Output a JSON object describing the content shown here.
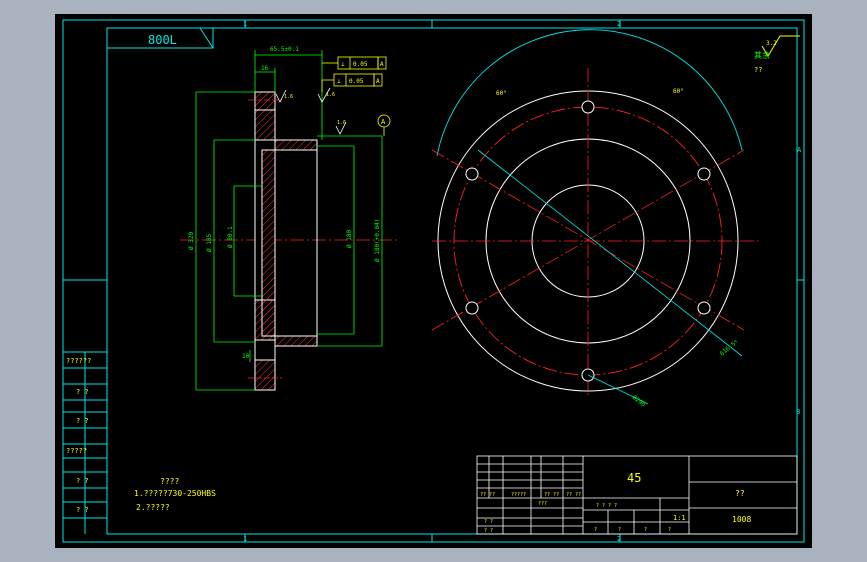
{
  "colors": {
    "background": "#000000",
    "frame": "#00e5e5",
    "outline": "#ffffff",
    "hatch": "#ff3030",
    "dimension": "#00ff00",
    "annotation": "#ffff00",
    "text": "#ffff00",
    "centerline": "#ff2020"
  },
  "drawing_number_box": "800L",
  "zone_labels": {
    "top1": "1",
    "top2": "2",
    "right_a": "A",
    "right_b": "B",
    "bottom1": "1",
    "bottom2": "2"
  },
  "roughness": {
    "value": "3.2",
    "mark": "其余",
    "note": "??"
  },
  "side_view": {
    "dim_top": "65.5±0.1",
    "dim_small": "16",
    "dim_small2": "12",
    "tol1_symbol": "⊥",
    "tol1_value": "0.05",
    "tol1_ref": "A",
    "tol2_symbol": "⊥",
    "tol2_value": "0.05",
    "tol2_ref": "A",
    "rough1": "1.6",
    "rough2": "1.6",
    "rough3": "1.6",
    "datum": "A",
    "dia_outer": "Ø 320",
    "dia_mid": "Ø 185",
    "dia_inner": "Ø 80.1",
    "dia_bore": "Ø 180",
    "dia_bore2": "Ø 180(+0.04)",
    "dim_bottom": "10"
  },
  "front_view": {
    "angle_left": "60°",
    "angle_right": "60°",
    "hole_label": "6ר16.5",
    "pcd_label": "Ø290"
  },
  "left_strip": [
    "??????",
    "? ?",
    "? ?",
    "?????",
    "? ?",
    "? ?"
  ],
  "notes": {
    "title": "????",
    "line1": "1.?????730-250HBS",
    "line2": "2.?????"
  },
  "title_block": {
    "material": "45",
    "name": "??",
    "number": "1008",
    "scale": "1:1",
    "row_labels": [
      "?? ??",
      "?????",
      "?? ??",
      "?? ??"
    ],
    "bottom_labels": [
      "? ?",
      "? ?"
    ],
    "mid_label": "???",
    "mini_header": "? ? ? ?",
    "mini_row": [
      "?",
      "?",
      "?",
      "?"
    ]
  }
}
